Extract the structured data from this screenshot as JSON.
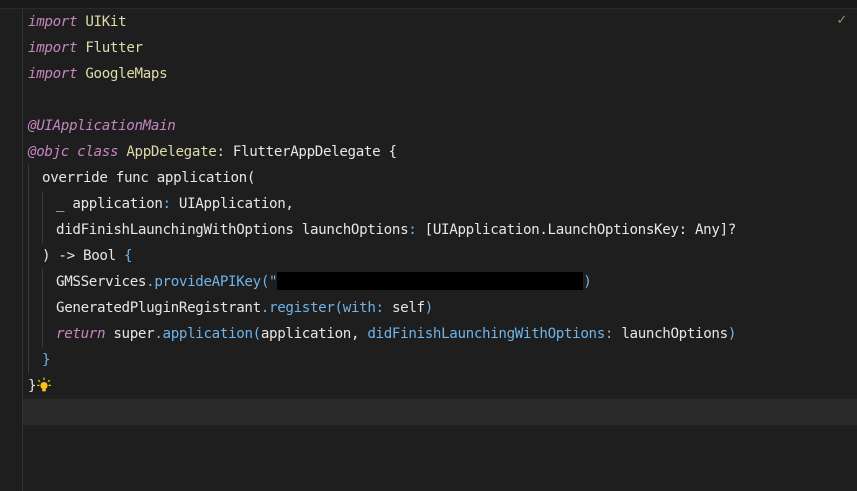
{
  "editor": {
    "status_icon": "checkmark-icon",
    "status_glyph": "✓"
  },
  "code": {
    "line1": {
      "kw": "import",
      "module": "UIKit"
    },
    "line2": {
      "kw": "import",
      "module": "Flutter"
    },
    "line3": {
      "kw": "import",
      "module": "GoogleMaps"
    },
    "line5": {
      "attr": "@UIApplicationMain"
    },
    "line6": {
      "attr": "@objc",
      "kw": "class",
      "name": "AppDelegate",
      "colon": ":",
      "super": "FlutterAppDelegate",
      "brace": "{"
    },
    "line7": {
      "kw": "override",
      "kw2": "func",
      "name": "application",
      "paren": "("
    },
    "line8": {
      "underscore": "_",
      "param": "application",
      "colon": ":",
      "type": "UIApplication",
      "comma": ","
    },
    "line9": {
      "label": "didFinishLaunchingWithOptions",
      "param": "launchOptions",
      "colon": ":",
      "type": "[UIApplication.LaunchOptionsKey: Any]?"
    },
    "line10": {
      "close": ")",
      "arrow": "->",
      "type": "Bool",
      "brace": "{"
    },
    "line11": {
      "obj": "GMSServices",
      "dot": ".",
      "method": "provideAPIKey",
      "open": "(\"",
      "close": ")"
    },
    "line12": {
      "obj": "GeneratedPluginRegistrant",
      "dot": ".",
      "method": "register",
      "open": "(",
      "label": "with",
      "colon": ":",
      "arg": "self",
      "close": ")"
    },
    "line13": {
      "kw": "return",
      "obj": "super",
      "dot": ".",
      "method": "application",
      "open": "(",
      "arg1": "application,",
      "label": "didFinishLaunchingWithOptions",
      "colon": ":",
      "arg2": "launchOptions",
      "close": ")"
    },
    "line14": {
      "brace": "}"
    },
    "line15": {
      "brace": "}"
    }
  },
  "colors": {
    "background": "#1e1e1e",
    "keyword": "#c586c0",
    "type": "#dcdcaa",
    "method": "#6fb3e8",
    "current_line": "#2a2a2a"
  }
}
